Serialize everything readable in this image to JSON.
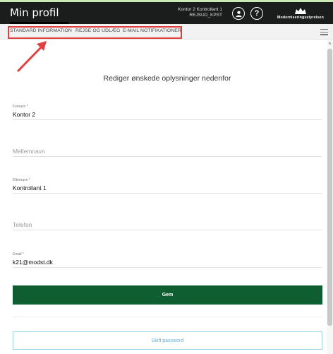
{
  "header": {
    "title": "Min profil",
    "user_name": "Kontor 2 Kontrollant 1",
    "user_org": "REJSUD_KPST",
    "logo_text": "Moderniseringsstyrelsen"
  },
  "tabs": [
    {
      "label": "STANDARD INFORMATION"
    },
    {
      "label": "REJSE OG UDLÆG"
    },
    {
      "label": "E-MAIL NOTIFIKATIONER"
    }
  ],
  "form": {
    "heading": "Rediger ønskede oplysninger nedenfor",
    "fornavn": {
      "label": "Fornavn *",
      "value": "Kontor 2"
    },
    "mellemnavn": {
      "placeholder": "Mellemnavn"
    },
    "efternavn": {
      "label": "Efternavn *",
      "value": "Kontrollant 1"
    },
    "telefon": {
      "placeholder": "Telefon"
    },
    "email": {
      "label": "Email *",
      "value": "k21@modst.dk"
    }
  },
  "buttons": {
    "save": "Gem",
    "change_password": "Skift password"
  },
  "colors": {
    "header_bg": "#1b1d1c",
    "save_button": "#0e5e32",
    "highlight": "#e0403f",
    "password_text": "#5fb3d8"
  }
}
